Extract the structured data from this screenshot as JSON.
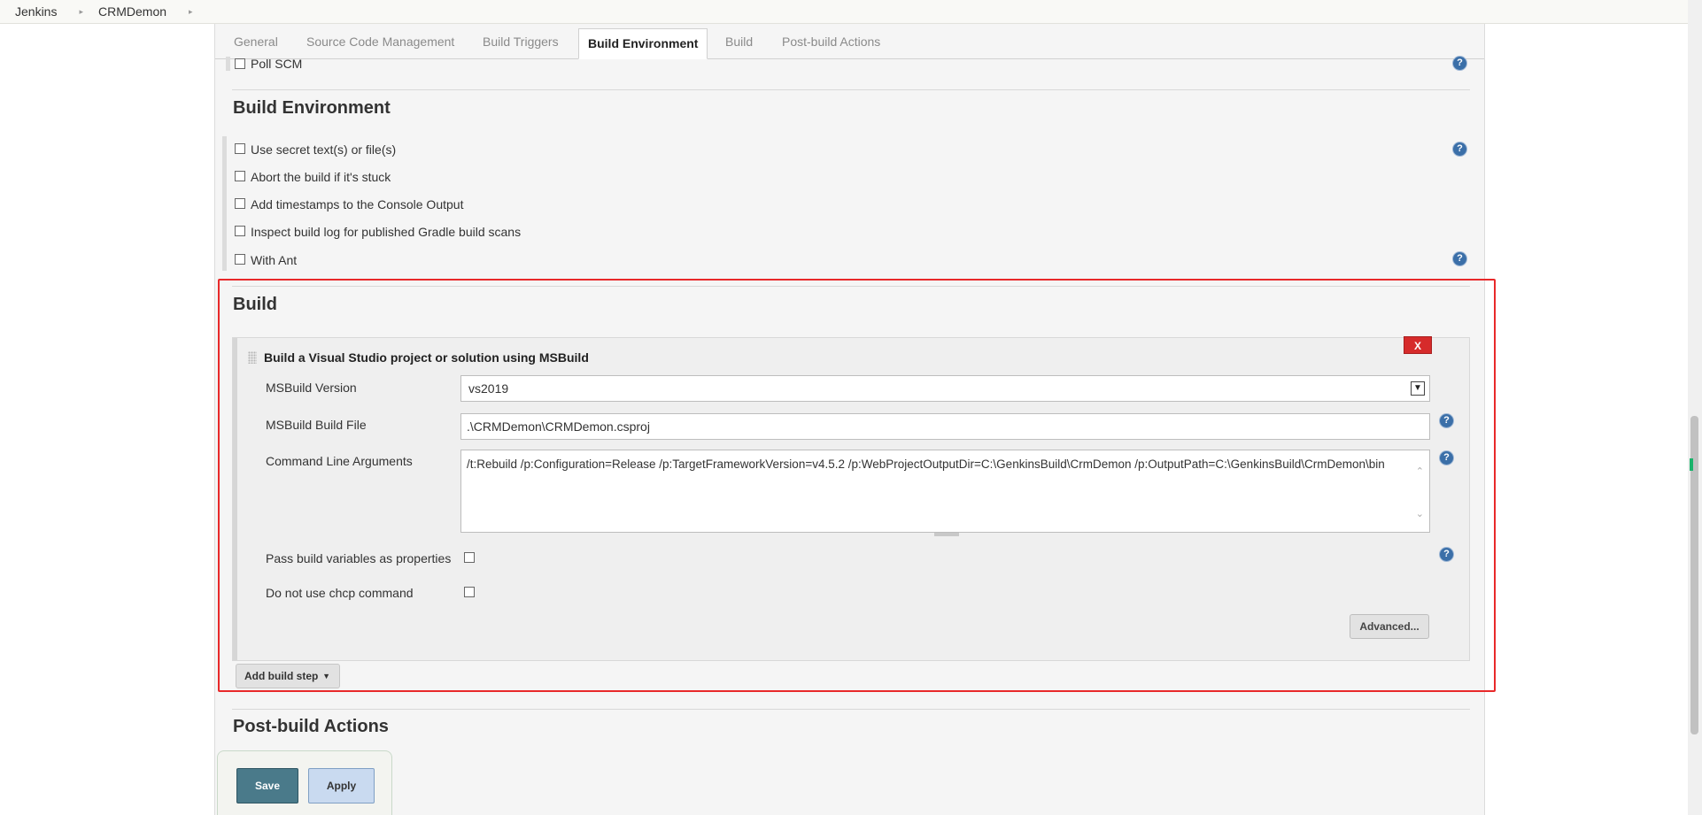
{
  "breadcrumb": [
    "Jenkins",
    "CRMDemon"
  ],
  "tabs": [
    "General",
    "Source Code Management",
    "Build Triggers",
    "Build Environment",
    "Build",
    "Post-build Actions"
  ],
  "active_tab": "Build Environment",
  "scm": {
    "poll_scm": "Poll SCM"
  },
  "build_environment": {
    "title": "Build Environment",
    "options": [
      "Use secret text(s) or file(s)",
      "Abort the build if it's stuck",
      "Add timestamps to the Console Output",
      "Inspect build log for published Gradle build scans",
      "With Ant"
    ]
  },
  "build": {
    "title": "Build",
    "step_title": "Build a Visual Studio project or solution using MSBuild",
    "remove_label": "X",
    "msbuild_version_label": "MSBuild Version",
    "msbuild_version_value": "vs2019",
    "build_file_label": "MSBuild Build File",
    "build_file_value": ".\\CRMDemon\\CRMDemon.csproj",
    "cmd_args_label": "Command Line Arguments",
    "cmd_args_value": "/t:Rebuild /p:Configuration=Release /p:TargetFrameworkVersion=v4.5.2 /p:WebProjectOutputDir=C:\\GenkinsBuild\\CrmDemon /p:OutputPath=C:\\GenkinsBuild\\CrmDemon\\bin",
    "pass_vars_label": "Pass build variables as properties",
    "no_chcp_label": "Do not use chcp command",
    "advanced_label": "Advanced...",
    "add_step_label": "Add build step"
  },
  "post_build": {
    "title": "Post-build Actions"
  },
  "footer": {
    "save_label": "Save",
    "apply_label": "Apply"
  },
  "help_symbol": "?",
  "colors": {
    "highlight": "#e8292a",
    "save": "#4a7a8a",
    "apply": "#c9daf0",
    "remove": "#d62b2b"
  }
}
